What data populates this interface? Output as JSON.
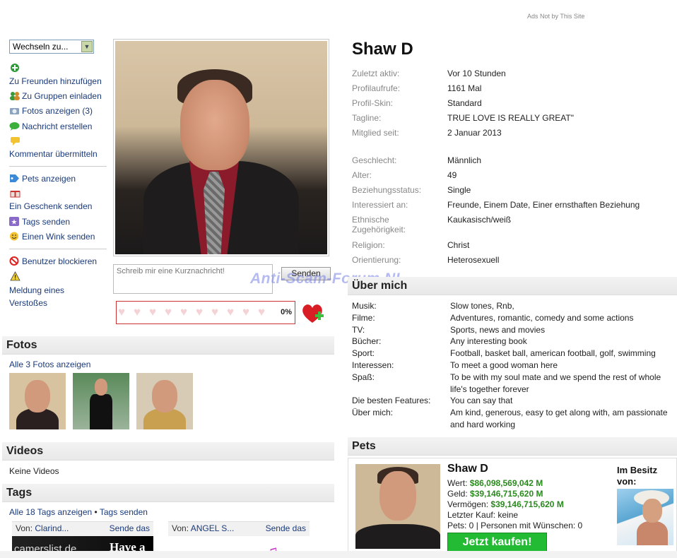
{
  "ads_note": "Ads Not by This Site",
  "switch_select": {
    "value": "Wechseln zu..."
  },
  "sidebar": {
    "add_friends": "Zu Freunden hinzufügen",
    "invite_groups": "Zu Gruppen einladen",
    "show_photos": "Fotos anzeigen (3)",
    "create_message": "Nachricht erstellen",
    "submit_comment": "Kommentar übermitteln",
    "show_pets": "Pets anzeigen",
    "send_gift": "Ein Geschenk senden",
    "send_tags": "Tags senden",
    "send_wink": "Einen Wink senden",
    "block_user": "Benutzer blockieren",
    "report_violation": "Meldung eines Verstoßes"
  },
  "quick_message": {
    "placeholder": "Schreib mir eine Kurznachricht!",
    "send_label": "Senden"
  },
  "rating": {
    "percent": "0%",
    "value_fraction": 0
  },
  "watermark": "Anti-Scam-Forum.NL",
  "photos_section": {
    "title": "Fotos",
    "show_all": "Alle 3 Fotos anzeigen"
  },
  "videos_section": {
    "title": "Videos",
    "empty": "Keine Videos"
  },
  "tags_section": {
    "title": "Tags",
    "show_all": "Alle 18 Tags anzeigen",
    "bullet": "•",
    "send_tags": "Tags senden",
    "cards": [
      {
        "from_label": "Von:",
        "from_name": "Clarind...",
        "send_label": "Sende das",
        "image_text": "camerslist.de",
        "image_text2": "Have a"
      },
      {
        "from_label": "Von:",
        "from_name": "ANGEL S...",
        "send_label": "Sende das"
      }
    ]
  },
  "profile": {
    "name": "Shaw D",
    "details": [
      {
        "label": "Zuletzt aktiv:",
        "value": "Vor 10 Stunden"
      },
      {
        "label": "Profilaufrufe:",
        "value": "1161 Mal"
      },
      {
        "label": "Profil-Skin:",
        "value": "Standard"
      },
      {
        "label": "Tagline:",
        "value": "TRUE LOVE IS REALLY GREAT\""
      },
      {
        "label": "Mitglied seit:",
        "value": "2 Januar 2013"
      }
    ],
    "personal": [
      {
        "label": "Geschlecht:",
        "value": "Männlich"
      },
      {
        "label": "Alter:",
        "value": "49"
      },
      {
        "label": "Beziehungsstatus:",
        "value": "Single"
      },
      {
        "label": "Interessiert an:",
        "value": "Freunde, Einem Date, Einer ernsthaften Beziehung"
      },
      {
        "label": "Ethnische Zugehörigkeit:",
        "value": "Kaukasisch/weiß"
      },
      {
        "label": "Religion:",
        "value": "Christ"
      },
      {
        "label": "Orientierung:",
        "value": "Heterosexuell"
      }
    ]
  },
  "about": {
    "title": "Über mich",
    "items": [
      {
        "label": "Musik:",
        "value": "Slow tones, Rnb,"
      },
      {
        "label": "Filme:",
        "value": "Adventures, romantic, comedy and some actions"
      },
      {
        "label": "TV:",
        "value": "Sports, news and movies"
      },
      {
        "label": "Bücher:",
        "value": "Any interesting book"
      },
      {
        "label": "Sport:",
        "value": "Football, basket ball, american football, golf, swimming"
      },
      {
        "label": "Interessen:",
        "value": "To meet a good woman here"
      },
      {
        "label": "Spaß:",
        "value": "To be with my soul mate and we spend the rest of whole life's together forever"
      },
      {
        "label": "Die besten Features:",
        "value": "You can say that"
      },
      {
        "label": "Über mich:",
        "value": "Am kind, generous, easy to get along with, am passionate and hard working"
      }
    ]
  },
  "pets": {
    "title": "Pets",
    "name": "Shaw D",
    "worth_label": "Wert:",
    "worth": "$86,098,569,042 M",
    "money_label": "Geld:",
    "money": "$39,146,715,620 M",
    "assets_label": "Vermögen:",
    "assets": "$39,146,715,620 M",
    "last_purchase": "Letzter Kauf: keine",
    "pets_wishes": "Pets: 0 | Personen mit Wünschen: 0",
    "buy_label": "Jetzt kaufen!",
    "owner_label": "Im Besitz von:"
  },
  "colors": {
    "link": "#1a3a7a",
    "money_green": "#2a8a1e",
    "buy_button": "#22bb33",
    "rating_border": "#cc3333"
  }
}
